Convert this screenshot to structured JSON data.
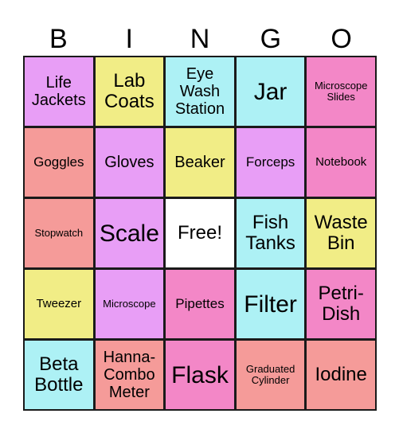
{
  "header": [
    "B",
    "I",
    "N",
    "G",
    "O"
  ],
  "colors": {
    "violet": "#e89ef6",
    "yellow": "#f1ed86",
    "cyan": "#adf1f5",
    "pink": "#f387c7",
    "salmon": "#f59b99",
    "free": "#ffffff",
    "border": "#1a1a1a"
  },
  "cells": [
    {
      "text": "Life\nJackets",
      "color": "violet",
      "size": "m"
    },
    {
      "text": "Lab\nCoats",
      "color": "yellow",
      "size": "l"
    },
    {
      "text": "Eye\nWash\nStation",
      "color": "cyan",
      "size": "m"
    },
    {
      "text": "Jar",
      "color": "cyan",
      "size": "xl"
    },
    {
      "text": "Microscope\nSlides",
      "color": "pink",
      "size": "xs"
    },
    {
      "text": "Goggles",
      "color": "salmon",
      "size": "sm"
    },
    {
      "text": "Gloves",
      "color": "violet",
      "size": "m"
    },
    {
      "text": "Beaker",
      "color": "yellow",
      "size": "m"
    },
    {
      "text": "Forceps",
      "color": "violet",
      "size": "sm"
    },
    {
      "text": "Notebook",
      "color": "pink",
      "size": "s"
    },
    {
      "text": "Stopwatch",
      "color": "salmon",
      "size": "xs"
    },
    {
      "text": "Scale",
      "color": "violet",
      "size": "xl"
    },
    {
      "text": "Free!",
      "color": "free",
      "size": "l"
    },
    {
      "text": "Fish\nTanks",
      "color": "cyan",
      "size": "l"
    },
    {
      "text": "Waste\nBin",
      "color": "yellow",
      "size": "l"
    },
    {
      "text": "Tweezer",
      "color": "yellow",
      "size": "s"
    },
    {
      "text": "Microscope",
      "color": "violet",
      "size": "xs"
    },
    {
      "text": "Pipettes",
      "color": "pink",
      "size": "sm"
    },
    {
      "text": "Filter",
      "color": "cyan",
      "size": "xl"
    },
    {
      "text": "Petri-\nDish",
      "color": "pink",
      "size": "l"
    },
    {
      "text": "Beta\nBottle",
      "color": "cyan",
      "size": "l"
    },
    {
      "text": "Hanna-\nCombo\nMeter",
      "color": "salmon",
      "size": "m"
    },
    {
      "text": "Flask",
      "color": "pink",
      "size": "xl"
    },
    {
      "text": "Graduated\nCylinder",
      "color": "salmon",
      "size": "xs"
    },
    {
      "text": "Iodine",
      "color": "salmon",
      "size": "l"
    }
  ]
}
